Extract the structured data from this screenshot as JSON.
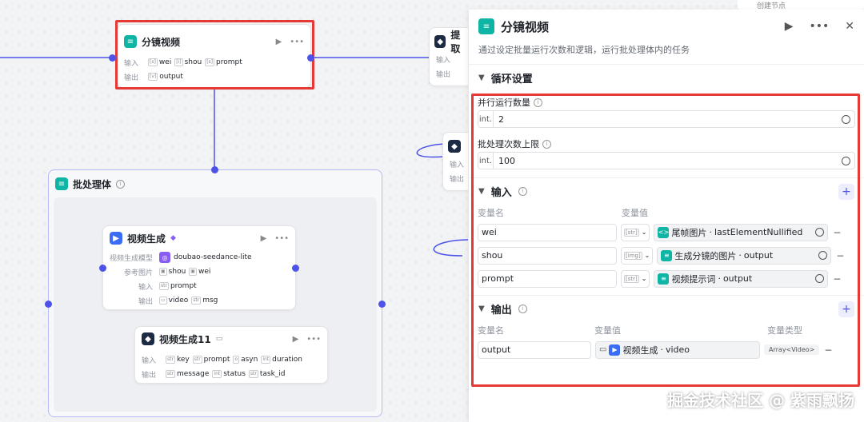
{
  "canvas": {
    "node_main": {
      "title": "分镜视频",
      "in_label": "输入",
      "inputs": [
        "wei",
        "shou",
        "prompt"
      ],
      "out_label": "输出",
      "outputs": [
        "output"
      ]
    },
    "node_extract": {
      "title": "提取",
      "in_label": "输入",
      "out_label": "输出"
    },
    "node_hidden": {
      "in_label": "输入",
      "out_label": "输出"
    },
    "batch": {
      "title": "批处理体"
    },
    "node_video": {
      "title": "视频生成",
      "model_label": "视频生成模型",
      "model": "doubao-seedance-lite",
      "ref_label": "参考图片",
      "refs": [
        "shou",
        "wei"
      ],
      "in_label": "输入",
      "inputs": [
        "prompt"
      ],
      "out_label": "输出",
      "outputs": [
        "video",
        "msg"
      ]
    },
    "node_video11": {
      "title": "视频生成11",
      "in_label": "输入",
      "inputs": [
        "key",
        "prompt",
        "asyn",
        "duration"
      ],
      "out_label": "输出",
      "outputs": [
        "message",
        "status",
        "task_id"
      ]
    },
    "corner_label": "创建节点"
  },
  "panel": {
    "title": "分镜视频",
    "description": "通过设定批量运行次数和逻辑，运行批处理体内的任务",
    "loop_section": "循环设置",
    "parallel_label": "并行运行数量",
    "parallel_type": "int.",
    "parallel_value": "2",
    "batch_limit_label": "批处理次数上限",
    "batch_limit_type": "int.",
    "batch_limit_value": "100",
    "input_section": "输入",
    "col_var_name": "变量名",
    "col_var_value": "变量值",
    "inputs": [
      {
        "name": "wei",
        "type": "[str]",
        "source": "尾帧图片",
        "field": "lastElementNullified"
      },
      {
        "name": "shou",
        "type": "[img]",
        "source": "生成分镜的图片",
        "field": "output"
      },
      {
        "name": "prompt",
        "type": "[str]",
        "source": "视频提示词",
        "field": "output"
      }
    ],
    "output_section": "输出",
    "col_var_type": "变量类型",
    "outputs": [
      {
        "name": "output",
        "source": "视频生成",
        "field": "video",
        "type": "Array<Video>"
      }
    ]
  },
  "watermark": "掘金技术社区 @ 紫雨飘扬",
  "colors": {
    "accent": "#4d53e8",
    "highlight": "#e53935",
    "teal": "#0fb5a4"
  }
}
